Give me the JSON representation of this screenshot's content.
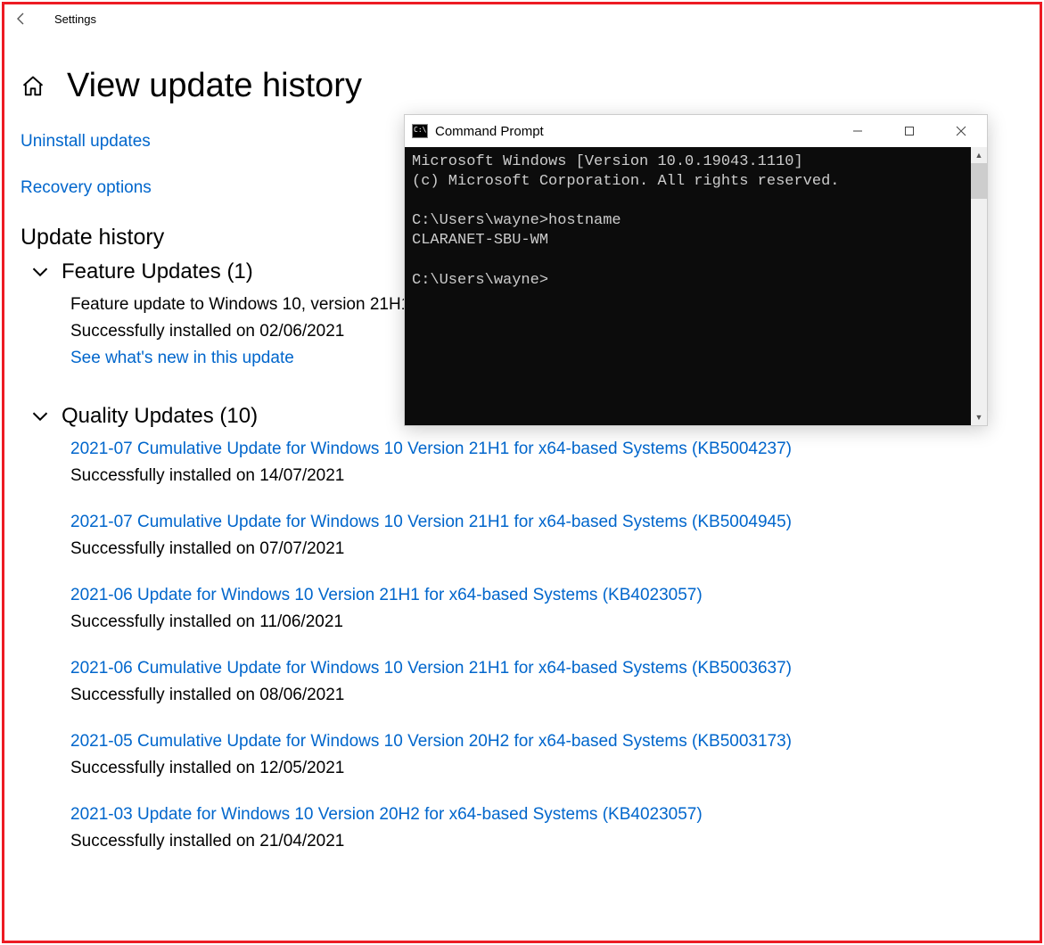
{
  "app": {
    "title": "Settings"
  },
  "page": {
    "title": "View update history"
  },
  "links": {
    "uninstall": "Uninstall updates",
    "recovery": "Recovery options"
  },
  "history": {
    "heading": "Update history",
    "feature_group": {
      "title": "Feature Updates (1)",
      "items": [
        {
          "title": "Feature update to Windows 10, version 21H1",
          "status": "Successfully installed on 02/06/2021",
          "link": "See what's new in this update"
        }
      ]
    },
    "quality_group": {
      "title": "Quality Updates (10)",
      "items": [
        {
          "title": "2021-07 Cumulative Update for Windows 10 Version 21H1 for x64-based Systems (KB5004237)",
          "status": "Successfully installed on 14/07/2021"
        },
        {
          "title": "2021-07 Cumulative Update for Windows 10 Version 21H1 for x64-based Systems (KB5004945)",
          "status": "Successfully installed on 07/07/2021"
        },
        {
          "title": "2021-06 Update for Windows 10 Version 21H1 for x64-based Systems (KB4023057)",
          "status": "Successfully installed on 11/06/2021"
        },
        {
          "title": "2021-06 Cumulative Update for Windows 10 Version 21H1 for x64-based Systems (KB5003637)",
          "status": "Successfully installed on 08/06/2021"
        },
        {
          "title": "2021-05 Cumulative Update for Windows 10 Version 20H2 for x64-based Systems (KB5003173)",
          "status": "Successfully installed on 12/05/2021"
        },
        {
          "title": "2021-03 Update for Windows 10 Version 20H2 for x64-based Systems (KB4023057)",
          "status": "Successfully installed on 21/04/2021"
        }
      ]
    }
  },
  "cmd": {
    "title": "Command Prompt",
    "lines": "Microsoft Windows [Version 10.0.19043.1110]\n(c) Microsoft Corporation. All rights reserved.\n\nC:\\Users\\wayne>hostname\nCLARANET-SBU-WM\n\nC:\\Users\\wayne>"
  }
}
